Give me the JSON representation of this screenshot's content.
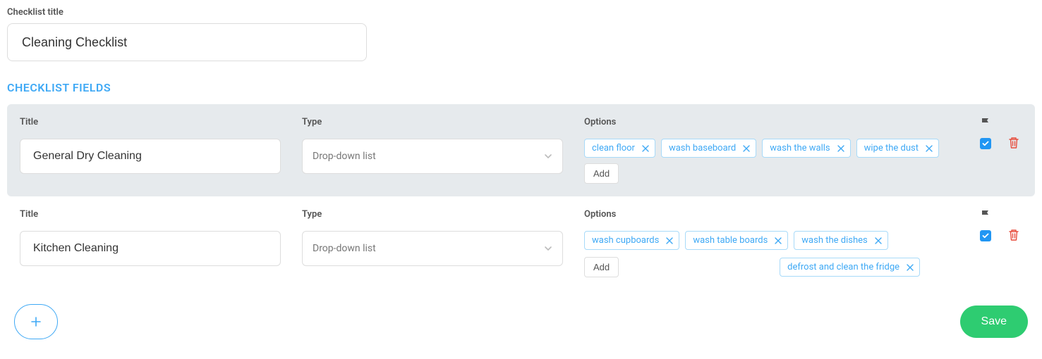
{
  "labels": {
    "checklist_title": "Checklist title",
    "section_heading": "CHECKLIST FIELDS",
    "col_title": "Title",
    "col_type": "Type",
    "col_options": "Options",
    "add": "Add",
    "save": "Save"
  },
  "checklist_title_value": "Cleaning Checklist",
  "fields": [
    {
      "highlight": true,
      "title": "General Dry Cleaning",
      "type": "Drop-down list",
      "options": [
        "clean floor",
        "wash baseboard",
        "wash the walls",
        "wipe the dust"
      ],
      "flagged": true,
      "add_inline": true,
      "extra_row": []
    },
    {
      "highlight": false,
      "title": "Kitchen Cleaning",
      "type": "Drop-down list",
      "options": [
        "wash cupboards",
        "wash table boards",
        "wash the dishes"
      ],
      "flagged": true,
      "add_inline": false,
      "extra_row": [
        "defrost and clean the fridge"
      ]
    }
  ]
}
